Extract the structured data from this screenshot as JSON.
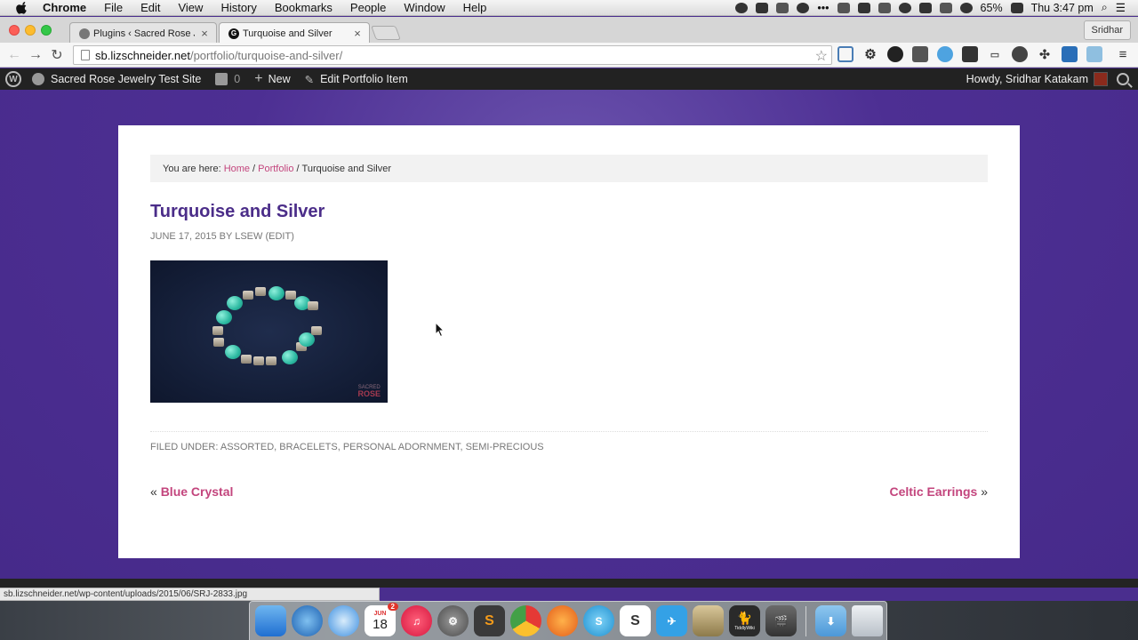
{
  "menubar": {
    "app_name": "Chrome",
    "items": [
      "File",
      "Edit",
      "View",
      "History",
      "Bookmarks",
      "People",
      "Window",
      "Help"
    ],
    "battery": "65%",
    "clock": "Thu 3:47 pm"
  },
  "browser": {
    "tabs": [
      {
        "label": "Plugins ‹ Sacred Rose Jew"
      },
      {
        "label": "Turquoise and Silver",
        "favicon": "G"
      }
    ],
    "profile": "Sridhar",
    "url_host": "sb.lizschneider.net",
    "url_path": "/portfolio/turquoise-and-silver/",
    "status_url": "sb.lizschneider.net/wp-content/uploads/2015/06/SRJ-2833.jpg"
  },
  "adminbar": {
    "site_name": "Sacred Rose Jewelry Test Site",
    "comments": "0",
    "new": "New",
    "edit": "Edit Portfolio Item",
    "howdy": "Howdy, Sridhar Katakam"
  },
  "breadcrumb": {
    "prefix": "You are here: ",
    "home": "Home",
    "portfolio": "Portfolio",
    "current": "Turquoise and Silver",
    "sep": "/"
  },
  "post": {
    "title": "Turquoise and Silver",
    "date": "June 17, 2015",
    "by": "by",
    "author": "lsew",
    "edit": "(Edit)",
    "watermark_top": "SACRED",
    "watermark_bottom": "ROSE",
    "filed_label": "Filed Under:",
    "categories": [
      "Assorted",
      "Bracelets",
      "Personal Adornment",
      "Semi-Precious"
    ],
    "prev": "Blue Crystal",
    "next": "Celtic Earrings"
  },
  "dock": {
    "calendar_day": "18",
    "calendar_month": "JUN",
    "calendar_badge": "2",
    "tiddlywiki_label": "TiddlyWiki"
  },
  "colors": {
    "accent_purple": "#4b2d89",
    "link_pink": "#c3457d",
    "admin_bar": "#222222"
  }
}
